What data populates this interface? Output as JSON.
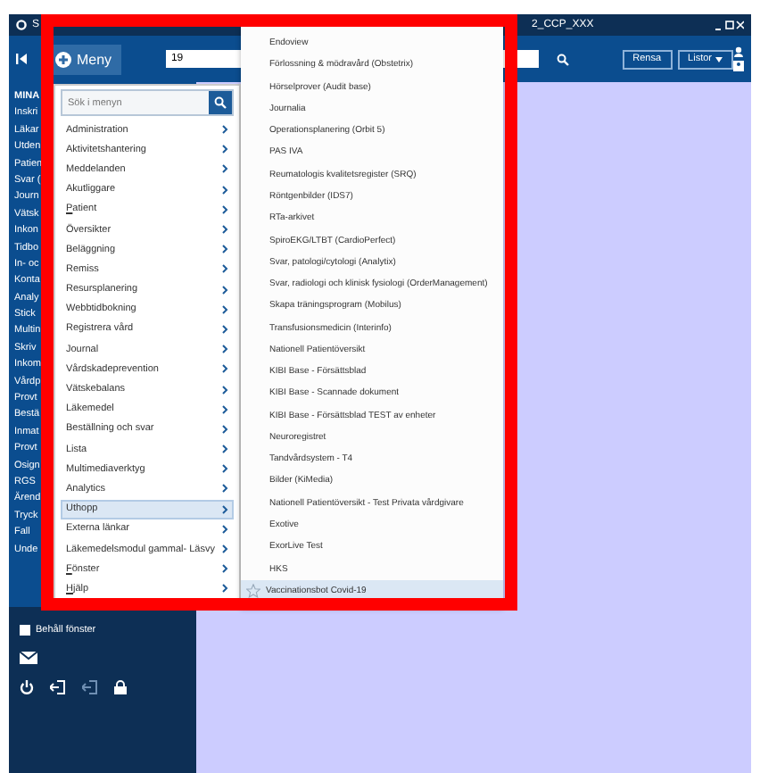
{
  "title_bar": {
    "app_initial": "S",
    "title_end": "2_CCP_XXX"
  },
  "toolbar": {
    "menu_button": "Meny",
    "search_value": "19",
    "buttons": [
      "Rensa",
      "Listor"
    ]
  },
  "sidebar": {
    "items": [
      "MINA",
      "Inskri",
      "Läkar",
      "Utden",
      "Patien",
      "Svar (",
      "Journ",
      "Vätsk",
      "Inkon",
      "Tidbo",
      "In- oc",
      "Konta",
      "Analy",
      "Stick",
      "Multin",
      "Skriv",
      "Inkom",
      "Vårdp",
      "Provt",
      "Bestä",
      "Inmat",
      "Provt",
      "Osign",
      "RGS",
      "Ärend",
      "Tryck",
      "Fall",
      "Unde"
    ],
    "keep_windows": {
      "label": "Behåll fönster",
      "checked": false
    }
  },
  "menu": {
    "search_placeholder": "Sök i menyn",
    "items": [
      {
        "label": "Administration",
        "selected": false,
        "underlined_initial": false
      },
      {
        "label": "Aktivitetshantering",
        "selected": false,
        "underlined_initial": false
      },
      {
        "label": "Meddelanden",
        "selected": false,
        "underlined_initial": false
      },
      {
        "label": "Akutliggare",
        "selected": false,
        "underlined_initial": false
      },
      {
        "label": "Patient",
        "selected": false,
        "underlined_initial": true
      },
      {
        "label": "Översikter",
        "selected": false,
        "underlined_initial": false
      },
      {
        "label": "Beläggning",
        "selected": false,
        "underlined_initial": false
      },
      {
        "label": "Remiss",
        "selected": false,
        "underlined_initial": false
      },
      {
        "label": "Resursplanering",
        "selected": false,
        "underlined_initial": false
      },
      {
        "label": "Webbtidbokning",
        "selected": false,
        "underlined_initial": false
      },
      {
        "label": "Registrera vård",
        "selected": false,
        "underlined_initial": false
      },
      {
        "label": "Journal",
        "selected": false,
        "underlined_initial": false
      },
      {
        "label": "Vårdskadeprevention",
        "selected": false,
        "underlined_initial": false
      },
      {
        "label": "Vätskebalans",
        "selected": false,
        "underlined_initial": false
      },
      {
        "label": "Läkemedel",
        "selected": false,
        "underlined_initial": false
      },
      {
        "label": "Beställning och svar",
        "selected": false,
        "underlined_initial": false
      },
      {
        "label": "Lista",
        "selected": false,
        "underlined_initial": false
      },
      {
        "label": "Multimediaverktyg",
        "selected": false,
        "underlined_initial": false
      },
      {
        "label": "Analytics",
        "selected": false,
        "underlined_initial": false
      },
      {
        "label": "Uthopp",
        "selected": true,
        "underlined_initial": false
      },
      {
        "label": "Externa länkar",
        "selected": false,
        "underlined_initial": false
      },
      {
        "label": "Läkemedelsmodul gammal- Läsvy",
        "selected": false,
        "underlined_initial": false
      },
      {
        "label": "Fönster",
        "selected": false,
        "underlined_initial": true
      },
      {
        "label": "Hjälp",
        "selected": false,
        "underlined_initial": true
      }
    ],
    "submenu": [
      {
        "label": "Endoview",
        "selected": false
      },
      {
        "label": "Förlossning & mödravård (Obstetrix)",
        "selected": false
      },
      {
        "label": "Hörselprover (Audit base)",
        "selected": false
      },
      {
        "label": "Journalia",
        "selected": false
      },
      {
        "label": "Operationsplanering (Orbit 5)",
        "selected": false
      },
      {
        "label": "PAS IVA",
        "selected": false
      },
      {
        "label": "Reumatologis kvalitetsregister (SRQ)",
        "selected": false
      },
      {
        "label": "Röntgenbilder (IDS7)",
        "selected": false
      },
      {
        "label": "RTa-arkivet",
        "selected": false
      },
      {
        "label": "SpiroEKG/LTBT (CardioPerfect)",
        "selected": false
      },
      {
        "label": "Svar, patologi/cytologi (Analytix)",
        "selected": false
      },
      {
        "label": "Svar, radiologi och klinisk fysiologi (OrderManagement)",
        "selected": false
      },
      {
        "label": "Skapa träningsprogram (Mobilus)",
        "selected": false
      },
      {
        "label": "Transfusionsmedicin (Interinfo)",
        "selected": false
      },
      {
        "label": "Nationell Patientöversikt",
        "selected": false
      },
      {
        "label": "KIBI Base - Försättsblad",
        "selected": false
      },
      {
        "label": "KIBI Base - Scannade dokument",
        "selected": false
      },
      {
        "label": "KIBI Base - Försättsblad TEST av enheter",
        "selected": false
      },
      {
        "label": "Neuroregistret",
        "selected": false
      },
      {
        "label": "Tandvårdsystem - T4",
        "selected": false
      },
      {
        "label": "Bilder (KiMedia)",
        "selected": false
      },
      {
        "label": "Nationell Patientöversikt - Test Privata vårdgivare",
        "selected": false
      },
      {
        "label": "Exotive",
        "selected": false
      },
      {
        "label": "ExorLive Test",
        "selected": false
      },
      {
        "label": "HKS",
        "selected": false
      },
      {
        "label": "Vaccinationsbot Covid-19",
        "selected": true
      }
    ]
  }
}
